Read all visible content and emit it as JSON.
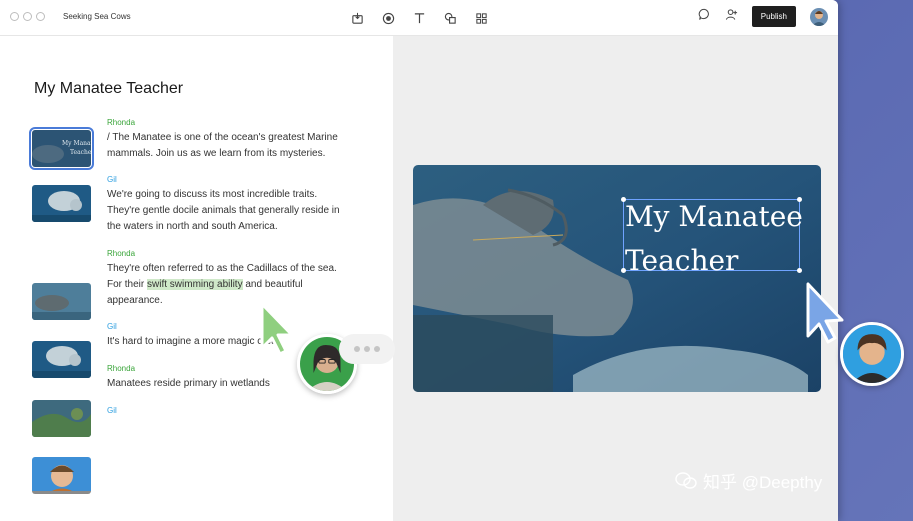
{
  "window": {
    "title": "Seeking Sea Cows"
  },
  "toolbar": {
    "icons": [
      "frame-icon",
      "record-icon",
      "text-icon",
      "shapes-icon",
      "grid-icon"
    ],
    "right_icons": [
      "comment-icon",
      "add-user-icon"
    ],
    "publish_label": "Publish"
  },
  "doc": {
    "title": "My Manatee Teacher",
    "entries": [
      {
        "speaker": "Rhonda",
        "lines": [
          "/ The Manatee is one of the ocean's greatest Marine",
          "mammals. Join us as we learn from its mysteries."
        ]
      },
      {
        "speaker": "Gil",
        "lines": [
          "We're going to discuss its most incredible traits.",
          "They're gentle docile animals that generally reside in",
          "the waters in north and south America."
        ]
      },
      {
        "speaker": "Rhonda",
        "lines": [
          "They're often referred to as the Cadillacs of the sea.",
          "For their",
          "swift swimming ability",
          "and beautiful",
          "appearance."
        ]
      },
      {
        "speaker": "Gil",
        "lines": [
          "It's hard to imagine a more magic creat"
        ]
      },
      {
        "speaker": "Rhonda",
        "lines": [
          "Manatees reside primary in wetlands"
        ]
      },
      {
        "speaker": "Gil",
        "lines": []
      }
    ]
  },
  "slide": {
    "title_line1": "My Manatee",
    "title_line2": "Teacher"
  },
  "colors": {
    "rhonda": "#3aa53a",
    "gil": "#2f9fe0",
    "cursor_green": "#8fcf7f",
    "cursor_blue": "#7aa5e6",
    "publish_bg": "#1f1f1f"
  },
  "watermark": "知乎 @Deepthy"
}
